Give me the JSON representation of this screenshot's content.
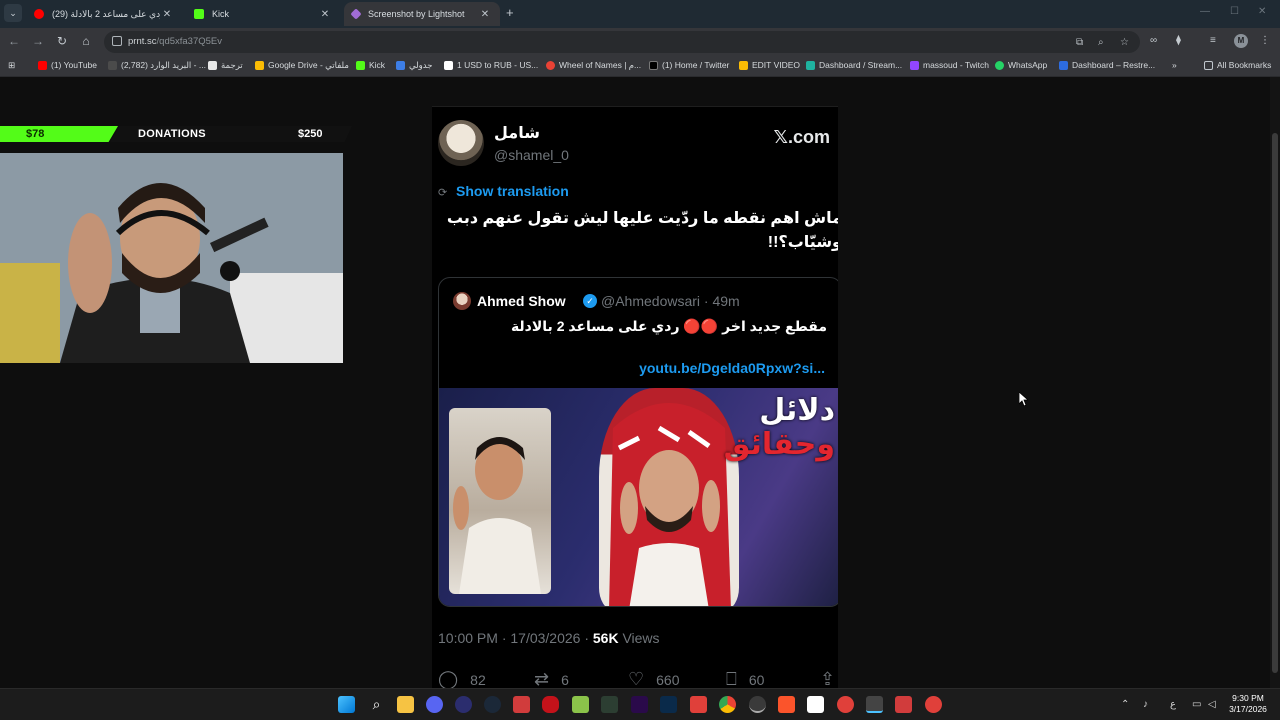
{
  "browser": {
    "tabs": [
      {
        "title": "(29) ردي على مساعد 2 بالادلة - ...",
        "favicon_color": "#ff0000",
        "active": false
      },
      {
        "title": "Kick",
        "favicon_color": "#53fc18",
        "active": false
      },
      {
        "title": "Screenshot by Lightshot",
        "favicon_color": "#a06cd5",
        "active": true
      }
    ],
    "new_tab": "+",
    "url_host": "prnt.sc",
    "url_path": "/qd5xfa37Q5Ev",
    "bookmarks": [
      {
        "label": "(1) YouTube",
        "color": "#ff0000"
      },
      {
        "label": "(2,782) البريد الوارد - ...",
        "color": "#4b4b4b"
      },
      {
        "label": "ترجمة",
        "color": "#f2f2f2"
      },
      {
        "label": "Google Drive - ملفاتي",
        "color": "#fbbc04"
      },
      {
        "label": "Kick",
        "color": "#53fc18"
      },
      {
        "label": "جدولي",
        "color": "#3d7ee6"
      },
      {
        "label": "1 USD to RUB - US...",
        "color": "#ffffff"
      },
      {
        "label": "Wheel of Names | م...",
        "color": "#e94235"
      },
      {
        "label": "(1) Home / Twitter",
        "color": "#000000"
      },
      {
        "label": "EDIT VIDEO",
        "color": "#fbbc04"
      },
      {
        "label": "Dashboard / Stream...",
        "color": "#1fb3a0"
      },
      {
        "label": "massoud - Twitch",
        "color": "#9146ff"
      },
      {
        "label": "WhatsApp",
        "color": "#25d366"
      },
      {
        "label": "Dashboard – Restre...",
        "color": "#2d6cdf"
      }
    ],
    "more_bookmarks": "»",
    "all_bookmarks": "All Bookmarks",
    "profile_initial": "M"
  },
  "overlay": {
    "donation_current": "$78",
    "donation_title": "DONATIONS",
    "donation_goal": "$250",
    "donation_progress": 0.312
  },
  "tweet": {
    "name": "شامل",
    "handle": "@shamel_0",
    "site": "𝕏.com",
    "show_translation": "Show translation",
    "text": "ماش اهم نقطه ما ردّيت عليها ليش تقول عنهم دبب وشيّاب؟!!",
    "quote": {
      "name": "Ahmed Show",
      "handle": "@Ahmedowsari · 49m",
      "text": "مقطع جديد اخر 🔴🔴 ردي على مساعد 2 بالادلة",
      "link": "youtu.be/Dgelda0Rpxw?si...",
      "thumb_word1": "دلائل",
      "thumb_word2": "وحقائق"
    },
    "time": "10:00 PM · 17/03/2026 · ",
    "views_count": "56K",
    "views_label": " Views",
    "replies": "82",
    "reposts": "6",
    "likes": "660",
    "bookmarks": "60"
  },
  "taskbar": {
    "lang": "ع",
    "time": "9:30 PM",
    "date": "3/17/2026"
  }
}
